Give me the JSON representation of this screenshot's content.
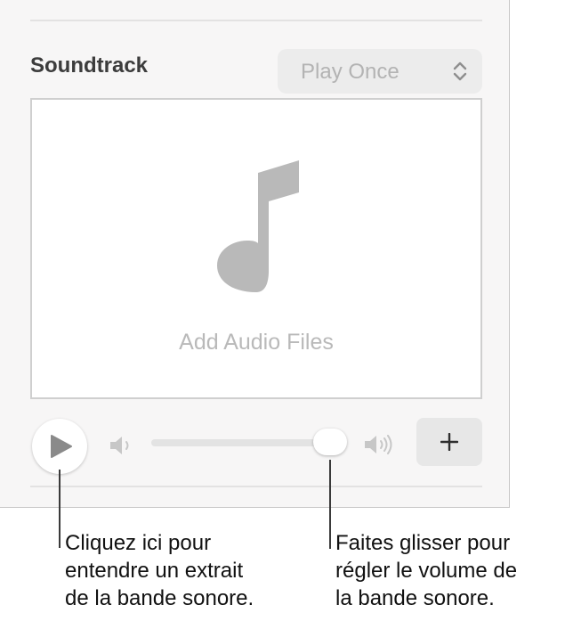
{
  "soundtrack": {
    "title": "Soundtrack",
    "playback_mode": "Play Once",
    "drop_zone_label": "Add Audio Files",
    "volume_level": 0.92
  },
  "icons": {
    "chevron": "up-down-chevron-icon",
    "note": "music-note-icon",
    "play": "play-icon",
    "volume_low": "speaker-low-icon",
    "volume_high": "speaker-high-icon",
    "add": "plus-icon"
  },
  "callouts": {
    "play": [
      "Cliquez ici pour",
      "entendre un extrait",
      "de la bande sonore."
    ],
    "volume": [
      "Faites glisser pour",
      "régler le volume de",
      "la bande sonore."
    ]
  },
  "colors": {
    "panel_bg": "#f7f6f6",
    "muted_text": "#b3b3b3",
    "title_text": "#3c3c3c"
  }
}
